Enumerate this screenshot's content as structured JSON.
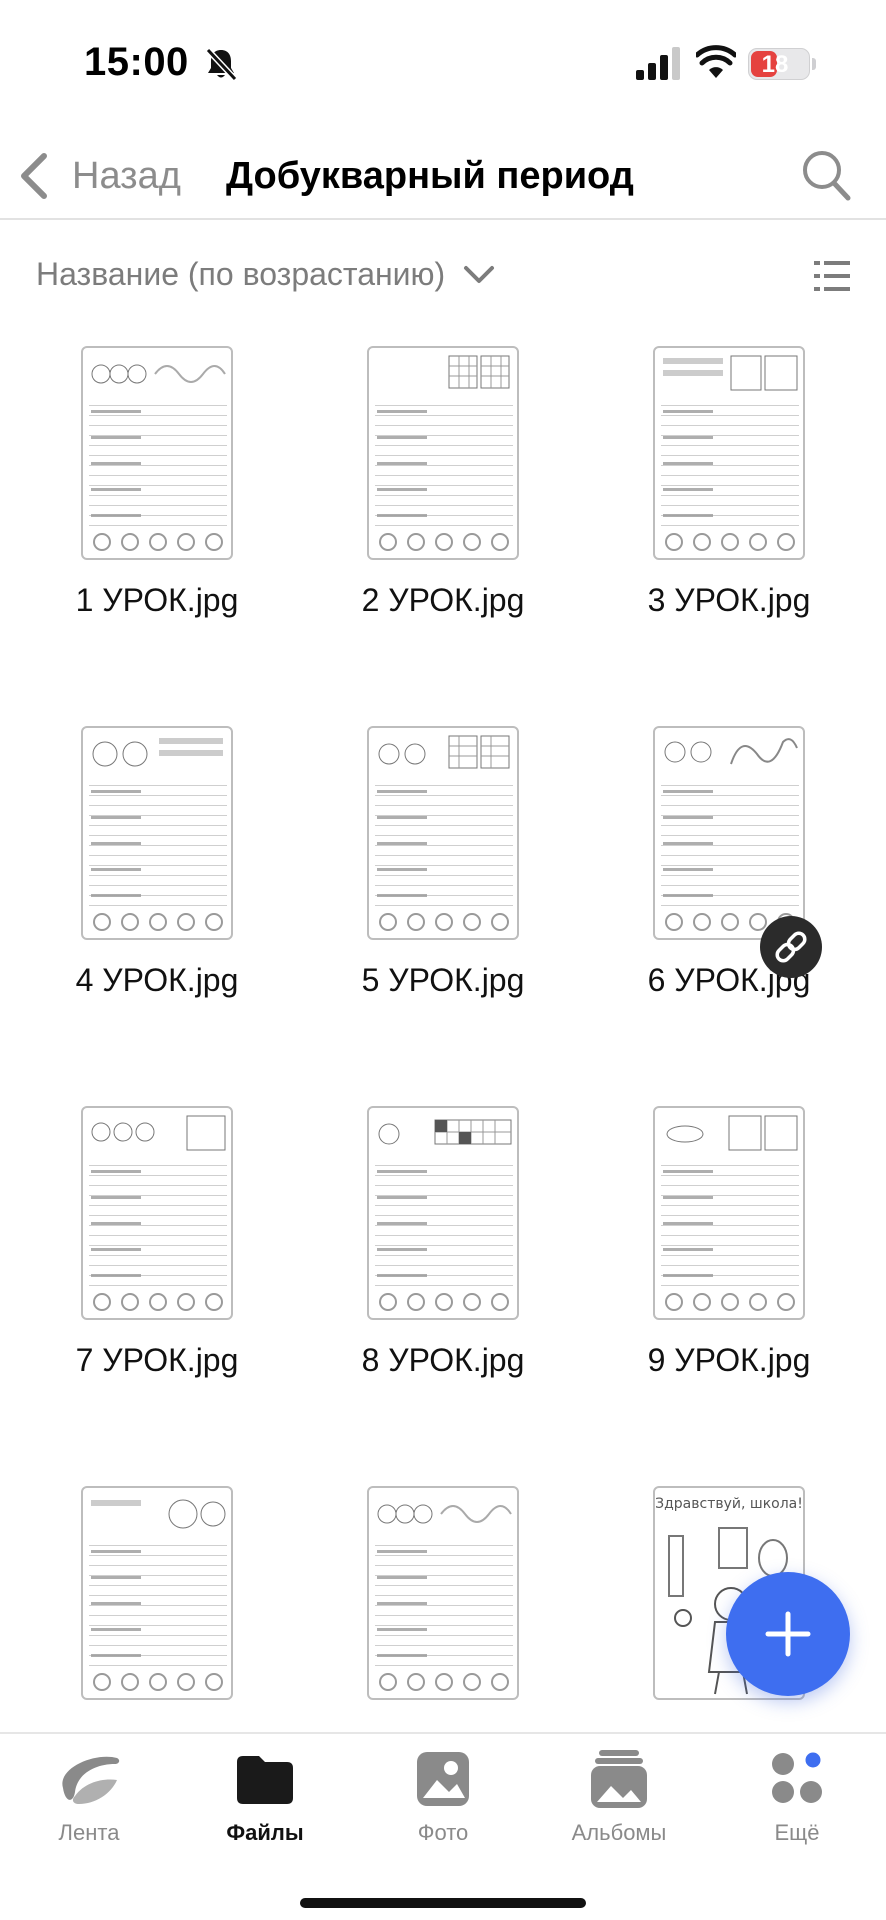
{
  "status_bar": {
    "time": "15:00",
    "battery_level": "18",
    "battery_fraction": 0.18,
    "icons": [
      "bell-slash-icon",
      "cellular-signal-icon",
      "wifi-icon",
      "battery-icon"
    ]
  },
  "nav": {
    "back_label": "Назад",
    "title": "Добукварный период",
    "icons": [
      "chevron-left-icon",
      "search-icon"
    ]
  },
  "sort": {
    "label": "Название (по возрастанию)",
    "icons": [
      "chevron-down-icon",
      "list-view-icon"
    ]
  },
  "files": [
    {
      "name": "1 УРОК.jpg"
    },
    {
      "name": "2 УРОК.jpg"
    },
    {
      "name": "3 УРОК.jpg"
    },
    {
      "name": "4 УРОК.jpg"
    },
    {
      "name": "5 УРОК.jpg"
    },
    {
      "name": "6 УРОК.jpg",
      "shared": true
    },
    {
      "name": "7 УРОК.jpg"
    },
    {
      "name": "8 УРОК.jpg"
    },
    {
      "name": "9 УРОК.jpg"
    },
    {
      "name": ""
    },
    {
      "name": ""
    },
    {
      "name": ""
    }
  ],
  "cover_thumbnail_text": "Здравствуй, школа!",
  "fab_icon": "plus-icon",
  "tab_bar": {
    "tabs": [
      {
        "label": "Лента",
        "icon": "feed-icon"
      },
      {
        "label": "Файлы",
        "icon": "folder-icon",
        "active": true
      },
      {
        "label": "Фото",
        "icon": "photo-icon"
      },
      {
        "label": "Альбомы",
        "icon": "albums-icon"
      },
      {
        "label": "Ещё",
        "icon": "more-apps-icon",
        "badge": true
      }
    ]
  },
  "colors": {
    "accent": "#3e6ef0",
    "battery_low": "#e5423f",
    "badge": "#3e6ef0"
  }
}
